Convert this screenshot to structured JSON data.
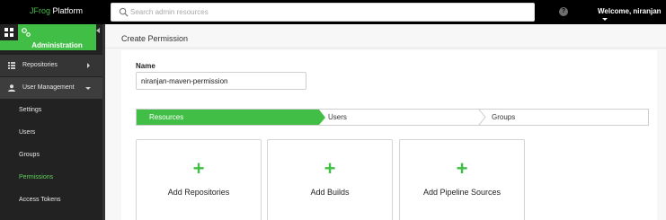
{
  "topbar": {
    "brand_j": "JFrog",
    "brand_rest": " Platform",
    "search_placeholder": "Search admin resources",
    "help_glyph": "?",
    "user_label": "Welcome, niranjan"
  },
  "sidebar": {
    "section_label": "Administration",
    "items": [
      {
        "label": "Repositories",
        "icon": "repositories-icon"
      },
      {
        "label": "User Management",
        "icon": "user-icon"
      }
    ],
    "sub_items": [
      {
        "label": "Settings"
      },
      {
        "label": "Users"
      },
      {
        "label": "Groups"
      },
      {
        "label": "Permissions"
      },
      {
        "label": "Access Tokens"
      }
    ],
    "active_sub_item": "Permissions"
  },
  "main": {
    "title": "Create Permission",
    "name_label": "Name",
    "name_value": "niranjan-maven-permission",
    "steps": [
      {
        "label": "Resources",
        "active": true
      },
      {
        "label": "Users",
        "active": false
      },
      {
        "label": "Groups",
        "active": false
      }
    ],
    "add_boxes": [
      {
        "plus": "+",
        "label": "Add Repositories"
      },
      {
        "plus": "+",
        "label": "Add Builds"
      },
      {
        "plus": "+",
        "label": "Add Pipeline Sources"
      }
    ]
  },
  "colors": {
    "accent": "#40be46",
    "topbar_bg": "#000000",
    "sidebar_bg": "#222222"
  }
}
